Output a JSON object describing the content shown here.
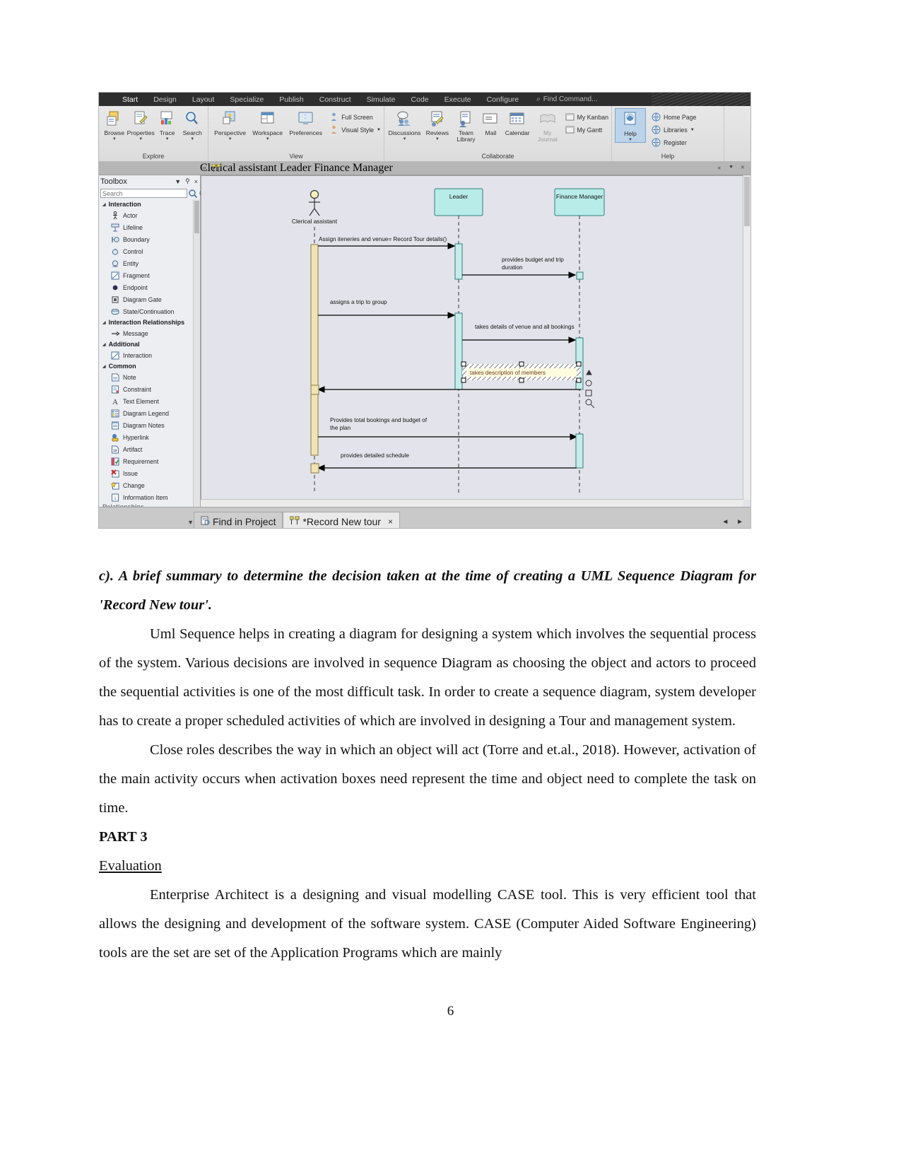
{
  "app": {
    "ribbon_tabs": [
      {
        "label": "Start",
        "active": true
      },
      {
        "label": "Design",
        "active": false
      },
      {
        "label": "Layout",
        "active": false
      },
      {
        "label": "Specialize",
        "active": false
      },
      {
        "label": "Publish",
        "active": false
      },
      {
        "label": "Construct",
        "active": false
      },
      {
        "label": "Simulate",
        "active": false
      },
      {
        "label": "Code",
        "active": false
      },
      {
        "label": "Execute",
        "active": false
      },
      {
        "label": "Configure",
        "active": false
      }
    ],
    "find_command": "Find Command...",
    "ribbon_groups": [
      {
        "name": "Explore",
        "buttons": [
          {
            "label": "Browse",
            "icon": "browse-icon",
            "has_caret": true
          },
          {
            "label": "Properties",
            "icon": "properties-icon",
            "has_caret": true
          },
          {
            "label": "Trace",
            "icon": "trace-icon",
            "has_caret": true
          },
          {
            "label": "Search",
            "icon": "search-icon",
            "has_caret": true
          }
        ]
      },
      {
        "name": "View",
        "buttons": [
          {
            "label": "Perspective",
            "icon": "perspective-icon",
            "has_caret": true
          },
          {
            "label": "Workspace",
            "icon": "workspace-icon",
            "has_caret": true
          },
          {
            "label": "Preferences",
            "icon": "preferences-icon",
            "has_caret": false
          }
        ],
        "small_buttons": [
          {
            "label": "Full Screen",
            "icon": "full-screen-icon"
          },
          {
            "label": "Visual Style",
            "icon": "visual-style-icon",
            "has_caret": true
          }
        ]
      },
      {
        "name": "Collaborate",
        "buttons": [
          {
            "label": "Discussions",
            "icon": "discussions-icon",
            "has_caret": true
          },
          {
            "label": "Reviews",
            "icon": "reviews-icon",
            "has_caret": true
          },
          {
            "label": "Team Library",
            "icon": "team-library-icon",
            "has_caret": false
          },
          {
            "label": "Mail",
            "icon": "mail-icon",
            "has_caret": false
          },
          {
            "label": "Calendar",
            "icon": "calendar-icon",
            "has_caret": false
          },
          {
            "label": "My Journal",
            "icon": "my-journal-icon",
            "has_caret": false,
            "disabled": true
          }
        ],
        "small_buttons": [
          {
            "label": "My Kanban",
            "icon": "my-kanban-icon"
          },
          {
            "label": "My Gantt",
            "icon": "my-gantt-icon"
          }
        ]
      },
      {
        "name": "Help",
        "buttons": [
          {
            "label": "Help",
            "icon": "help-icon",
            "has_caret": true,
            "selected": true
          }
        ],
        "small_buttons": [
          {
            "label": "Home Page",
            "icon": "home-page-icon"
          },
          {
            "label": "Libraries",
            "icon": "libraries-icon",
            "has_caret": true
          },
          {
            "label": "Register",
            "icon": "register-icon"
          }
        ]
      }
    ]
  },
  "toolbox": {
    "title": "Toolbox",
    "search_placeholder": "Search",
    "sections": [
      {
        "name": "Interaction",
        "items": [
          {
            "label": "Actor",
            "icon": "actor-icon"
          },
          {
            "label": "Lifeline",
            "icon": "lifeline-icon"
          },
          {
            "label": "Boundary",
            "icon": "boundary-icon"
          },
          {
            "label": "Control",
            "icon": "control-icon"
          },
          {
            "label": "Entity",
            "icon": "entity-icon"
          },
          {
            "label": "Fragment",
            "icon": "fragment-icon"
          },
          {
            "label": "Endpoint",
            "icon": "endpoint-icon"
          },
          {
            "label": "Diagram Gate",
            "icon": "diagram-gate-icon"
          },
          {
            "label": "State/Continuation",
            "icon": "state-continuation-icon"
          }
        ]
      },
      {
        "name": "Interaction Relationships",
        "items": [
          {
            "label": "Message",
            "icon": "message-arrow-icon"
          }
        ]
      },
      {
        "name": "Additional",
        "items": [
          {
            "label": "Interaction",
            "icon": "interaction-icon"
          }
        ]
      },
      {
        "name": "Common",
        "items": [
          {
            "label": "Note",
            "icon": "note-icon"
          },
          {
            "label": "Constraint",
            "icon": "constraint-icon"
          },
          {
            "label": "Text Element",
            "icon": "text-element-icon"
          },
          {
            "label": "Diagram Legend",
            "icon": "diagram-legend-icon"
          },
          {
            "label": "Diagram Notes",
            "icon": "diagram-notes-icon"
          },
          {
            "label": "Hyperlink",
            "icon": "hyperlink-icon"
          },
          {
            "label": "Artifact",
            "icon": "artifact-icon"
          },
          {
            "label": "Requirement",
            "icon": "requirement-icon"
          },
          {
            "label": "Issue",
            "icon": "issue-icon"
          },
          {
            "label": "Change",
            "icon": "change-icon"
          },
          {
            "label": "Information Item",
            "icon": "information-item-icon"
          }
        ]
      }
    ],
    "cut_off_label": "Relationships"
  },
  "diagram": {
    "column_headers": [
      "Clerical assistant",
      "Leader",
      "Finance Manager"
    ],
    "actor": {
      "name": "Clerical assistant"
    },
    "lifelines": [
      {
        "name": "Leader",
        "type": "object"
      },
      {
        "name": "Finance Manager",
        "type": "object"
      }
    ],
    "messages": [
      {
        "text": "Assign iteneries and venue= Record Tour details()",
        "from": "Clerical assistant",
        "to": "Leader"
      },
      {
        "text": "provides budget and trip duration",
        "from": "Leader",
        "to": "Finance Manager"
      },
      {
        "text": "assigns a trip to group",
        "from": "Clerical assistant",
        "to": "Leader"
      },
      {
        "text": "takes details of venue and all bookings",
        "from": "Leader",
        "to": "Finance Manager"
      },
      {
        "text": "Provides total bookings and budget of the plan",
        "from": "Clerical assistant",
        "to": "Finance Manager"
      },
      {
        "text": "provides detailed schedule",
        "from": "Finance Manager",
        "to": "Clerical assistant"
      }
    ],
    "selected_message": "takes description of members",
    "colors": {
      "object_fill": "#b8ece9",
      "actor_activation": "#f0e3b8",
      "activation": "#c6ebe9",
      "canvas": "#e3e3eb",
      "selected_note": "#fdfbe0"
    }
  },
  "bottom_tabs": [
    {
      "label": "Find in Project",
      "icon": "find-in-project-icon",
      "active": false,
      "closable": false
    },
    {
      "label": "*Record New tour",
      "icon": "diagram-tab-icon",
      "active": true,
      "closable": true
    }
  ],
  "nav_arrows": "◄ ►",
  "document": {
    "heading_c": "c). A brief summary to determine the decision taken at the time of creating a UML Sequence Diagram for 'Record New tour'.",
    "para1": "Uml Sequence helps in creating a diagram for designing a system which involves the sequential process of the system. Various decisions are involved in sequence Diagram as choosing the object and actors to proceed the sequential activities is one of the most difficult task. In order to create a sequence diagram, system developer has to create a proper scheduled activities of which are involved in designing a Tour and management system.",
    "para2": "Close roles describes the way in which an object will act (Torre and et.al., 2018). However, activation of the main activity occurs when activation boxes need represent the time and object need to complete the task on time.",
    "part_heading": "PART 3",
    "eval_heading": "Evaluation",
    "para3": "Enterprise Architect is a designing and visual modelling CASE tool. This is very efficient tool that allows the designing and development of the software system. CASE (Computer Aided Software Engineering) tools are the set are set of the Application Programs which are mainly",
    "page_number": "6"
  }
}
